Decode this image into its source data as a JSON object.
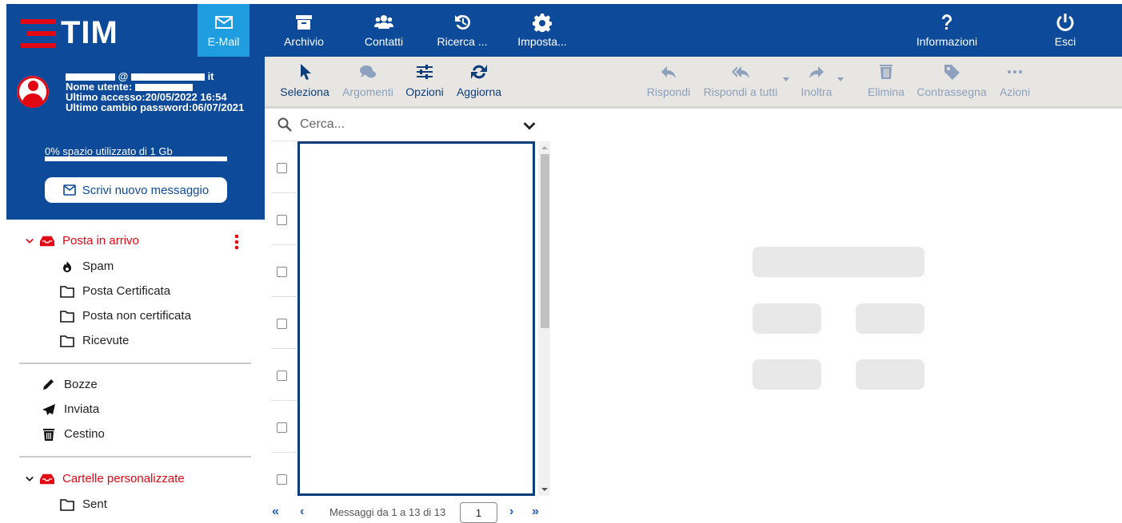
{
  "brand": {
    "name": "TIM",
    "accent": "#e30613",
    "primary": "#0d4a9a"
  },
  "topnav": {
    "email": "E-Mail",
    "archive": "Archivio",
    "contacts": "Contatti",
    "search": "Ricerca ...",
    "settings": "Imposta...",
    "info": "Informazioni",
    "logout": "Esci"
  },
  "user": {
    "email_at": "@",
    "email_tld": "it",
    "username_label": "Nome utente:",
    "last_access": "Ultimo accesso:20/05/2022 16:54",
    "last_pwd_change": "Ultimo cambio password:06/07/2021",
    "space": "0% spazio utilizzato di 1 Gb",
    "space_used_fraction": 0
  },
  "compose_label": "Scrivi nuovo messaggio",
  "folders": {
    "inbox": "Posta in arrivo",
    "spam": "Spam",
    "certified": "Posta Certificata",
    "non_certified": "Posta non certificata",
    "received": "Ricevute",
    "drafts": "Bozze",
    "sent": "Inviata",
    "trash": "Cestino",
    "custom": "Cartelle personalizzate",
    "custom_sent": "Sent"
  },
  "toolbar": {
    "select": "Seleziona",
    "topics": "Argomenti",
    "options": "Opzioni",
    "refresh": "Aggiorna",
    "reply": "Rispondi",
    "reply_all": "Rispondi a tutti",
    "forward": "Inoltra",
    "delete": "Elimina",
    "flag": "Contrassegna",
    "actions": "Azioni"
  },
  "search": {
    "placeholder": "Cerca..."
  },
  "pager": {
    "summary": "Messaggi da 1 a 13 di 13",
    "page": "1"
  }
}
